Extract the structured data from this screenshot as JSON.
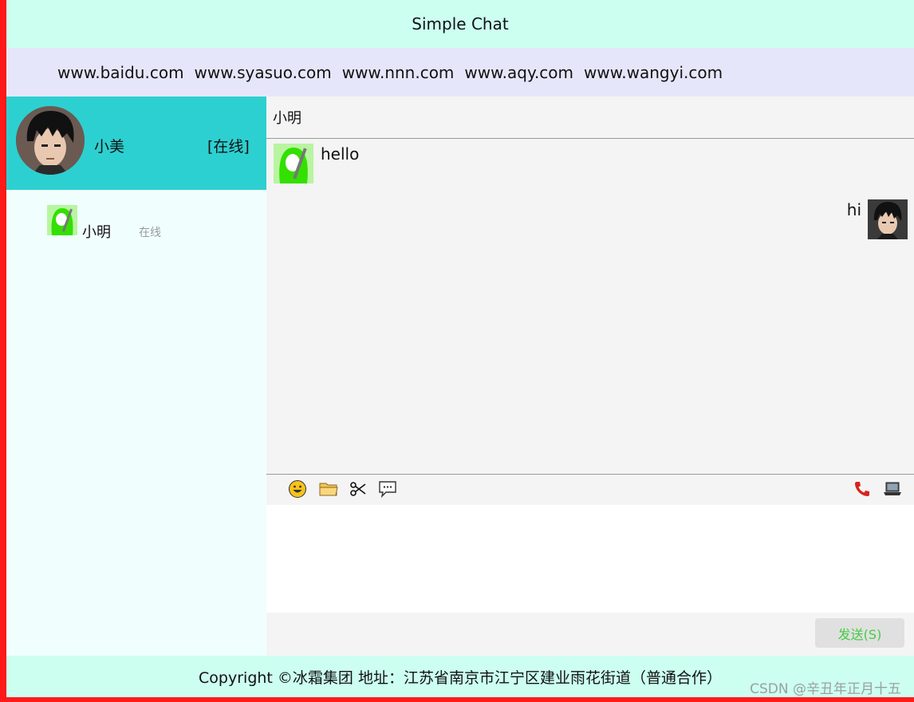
{
  "header": {
    "title": "Simple Chat"
  },
  "nav": {
    "links": [
      "www.baidu.com",
      "www.syasuo.com",
      "www.nnn.com",
      "www.aqy.com",
      "www.wangyi.com"
    ]
  },
  "me": {
    "name": "小美",
    "status": "[在线]"
  },
  "contacts": [
    {
      "name": "小明",
      "status": "在线"
    }
  ],
  "chat": {
    "title": "小明",
    "messages": [
      {
        "side": "left",
        "text": "hello"
      },
      {
        "side": "right",
        "text": "hi"
      }
    ]
  },
  "toolbar": {
    "left_icons": [
      "emoji-icon",
      "folder-icon",
      "scissors-icon",
      "chat-bubble-icon"
    ],
    "right_icons": [
      "phone-icon",
      "laptop-icon"
    ]
  },
  "input": {
    "value": "",
    "placeholder": ""
  },
  "send": {
    "label": "发送(S)"
  },
  "footer": {
    "text": "Copyright ©冰霜集团 地址：江苏省南京市江宁区建业雨花街道（普通合作）"
  },
  "watermark": "CSDN @辛丑年正月十五",
  "colors": {
    "header_bg": "#ccfff0",
    "nav_bg": "#e6e6fa",
    "sidebar_bg": "#f0fffe",
    "me_bg": "#2dd0d0",
    "chat_bg": "#f4f4f4",
    "send_text": "#44cc44",
    "frame": "#ff1a1a"
  }
}
